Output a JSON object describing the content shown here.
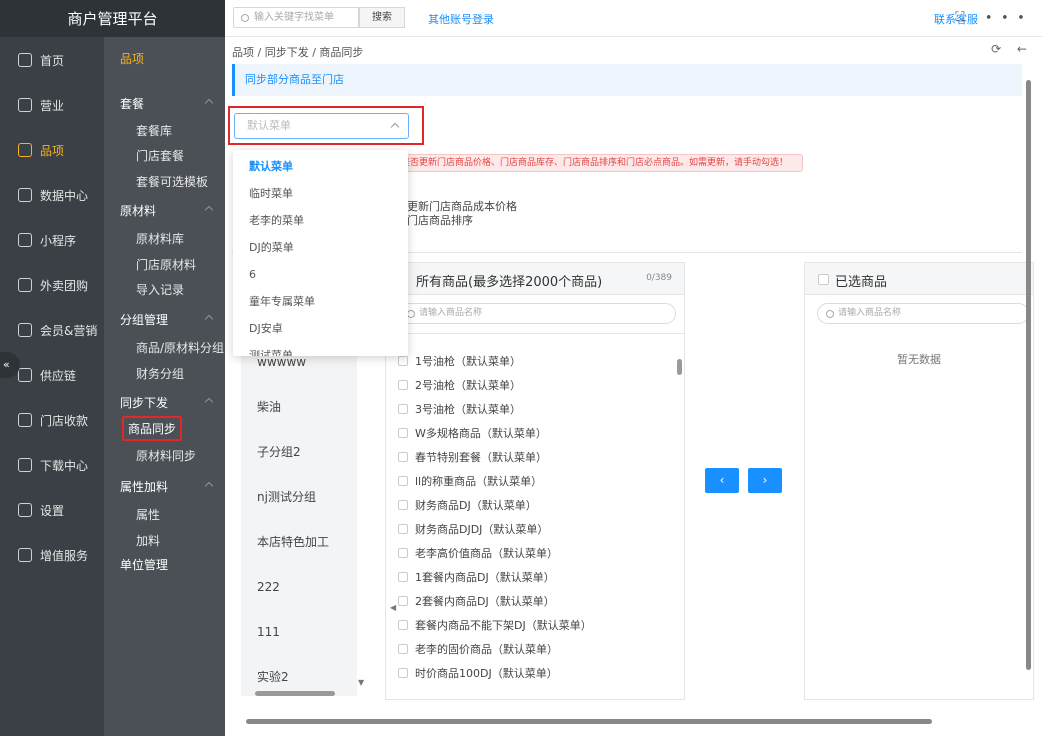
{
  "brand": "商户管理平台",
  "nav1": [
    {
      "label": "首页"
    },
    {
      "label": "营业"
    },
    {
      "label": "品项",
      "active": true
    },
    {
      "label": "数据中心"
    },
    {
      "label": "小程序"
    },
    {
      "label": "外卖团购"
    },
    {
      "label": "会员&营销"
    },
    {
      "label": "供应链"
    },
    {
      "label": "门店收款"
    },
    {
      "label": "下载中心"
    },
    {
      "label": "设置"
    },
    {
      "label": "增值服务"
    }
  ],
  "nav2": {
    "title": "品项",
    "groups": [
      "套餐",
      "原材料",
      "分组管理",
      "同步下发",
      "属性加料",
      "单位管理"
    ],
    "subs": [
      "套餐库",
      "门店套餐",
      "套餐可选模板",
      "原材料库",
      "门店原材料",
      "导入记录",
      "商品/原材料分组",
      "财务分组",
      "商品同步",
      "原材料同步",
      "属性",
      "加料"
    ]
  },
  "topbar": {
    "search_placeholder": "输入关键字找菜单",
    "search_btn": "搜索",
    "other_login": "其他账号登录",
    "service": "联系客服",
    "icons": "⛶ ∙∙∙"
  },
  "crumb": "品项 / 同步下发 / 商品同步",
  "crumb_tools": "⟳ ←",
  "infobar": "同步部分商品至门店",
  "select": {
    "placeholder": "默认菜单"
  },
  "dropdown": [
    "默认菜单",
    "临时菜单",
    "老李的菜单",
    "DJ的菜单",
    "6",
    "童年专属菜单",
    "DJ安卓",
    "测试菜单"
  ],
  "warn": "是否更新门店商品价格、门店商品库存、门店商品排序和门店必点商品。如需更新，请手动勾选！",
  "opt1": "更新门店商品成本价格",
  "opt2": "门店商品排序",
  "categories": [
    "wwwww",
    "柴油",
    "子分组2",
    "nj测试分组",
    "本店特色加工",
    "222",
    "111",
    "实验2"
  ],
  "left_panel": {
    "title": "所有商品(最多选择2000个商品)",
    "count": "0/389",
    "filter_placeholder": "请输入商品名称",
    "items": [
      "1号油枪（默认菜单）",
      "2号油枪（默认菜单）",
      "3号油枪（默认菜单）",
      "W多规格商品（默认菜单）",
      "春节特别套餐（默认菜单）",
      "ll的称重商品（默认菜单）",
      "财务商品DJ（默认菜单）",
      "财务商品DJDJ（默认菜单）",
      "老李高价值商品（默认菜单）",
      "1套餐内商品DJ（默认菜单）",
      "2套餐内商品DJ（默认菜单）",
      "套餐内商品不能下架DJ（默认菜单）",
      "老李的固价商品（默认菜单）",
      "时价商品100DJ（默认菜单）"
    ]
  },
  "right_panel": {
    "title": "已选商品",
    "filter_placeholder": "请输入商品名称",
    "empty": "暂无数据"
  },
  "arrows": {
    "left": "‹",
    "right": "›"
  },
  "collapse": "«"
}
